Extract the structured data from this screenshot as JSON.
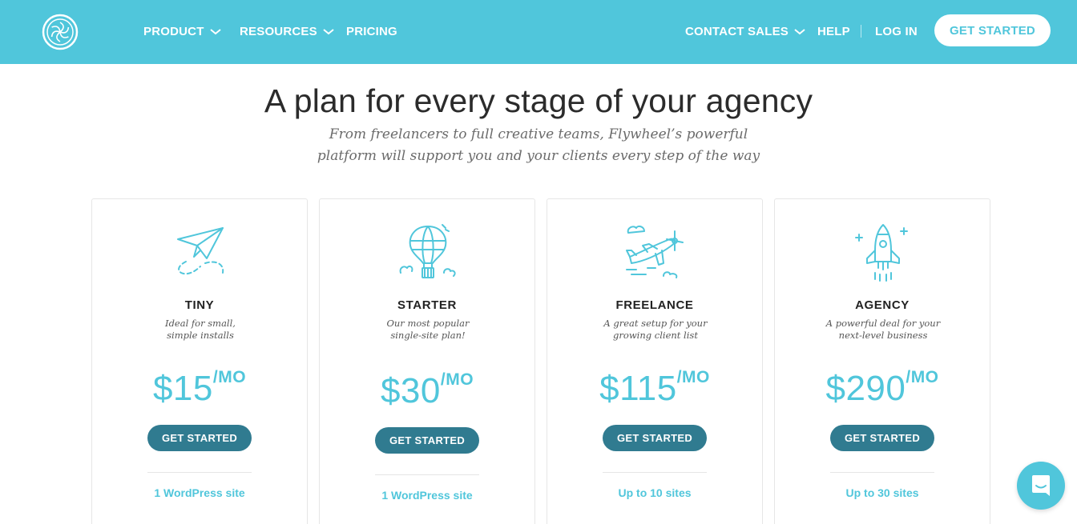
{
  "brand": {
    "logo_icon": "flywheel-logo-icon",
    "accent": "#50c6db",
    "button_dark": "#307b90"
  },
  "nav": {
    "product": "PRODUCT",
    "resources": "RESOURCES",
    "pricing": "PRICING",
    "contact_sales": "CONTACT SALES",
    "help": "HELP",
    "login": "LOG IN",
    "cta": "GET STARTED"
  },
  "hero": {
    "title": "A plan for every stage of your agency",
    "subtitle_line1": "From freelancers to full creative teams, Flywheel’s powerful",
    "subtitle_line2": "platform will support you and your clients every step of the way"
  },
  "plans": [
    {
      "icon": "paper-plane-icon",
      "name": "TINY",
      "desc1": "Ideal for small,",
      "desc2": "simple installs",
      "price": "$15",
      "per": "/MO",
      "cta": "GET STARTED",
      "feature": "1 WordPress site"
    },
    {
      "icon": "hot-air-balloon-icon",
      "name": "STARTER",
      "desc1": "Our most popular",
      "desc2": "single-site plan!",
      "price": "$30",
      "per": "/MO",
      "cta": "GET STARTED",
      "feature": "1 WordPress site"
    },
    {
      "icon": "airplane-icon",
      "name": "FREELANCE",
      "desc1": "A great setup for your",
      "desc2": "growing client list",
      "price": "$115",
      "per": "/MO",
      "cta": "GET STARTED",
      "feature": "Up to 10 sites"
    },
    {
      "icon": "rocket-icon",
      "name": "AGENCY",
      "desc1": "A powerful deal for your",
      "desc2": "next-level business",
      "price": "$290",
      "per": "/MO",
      "cta": "GET STARTED",
      "feature": "Up to 30 sites"
    }
  ],
  "chat": {
    "icon": "chat-bubble-icon"
  }
}
